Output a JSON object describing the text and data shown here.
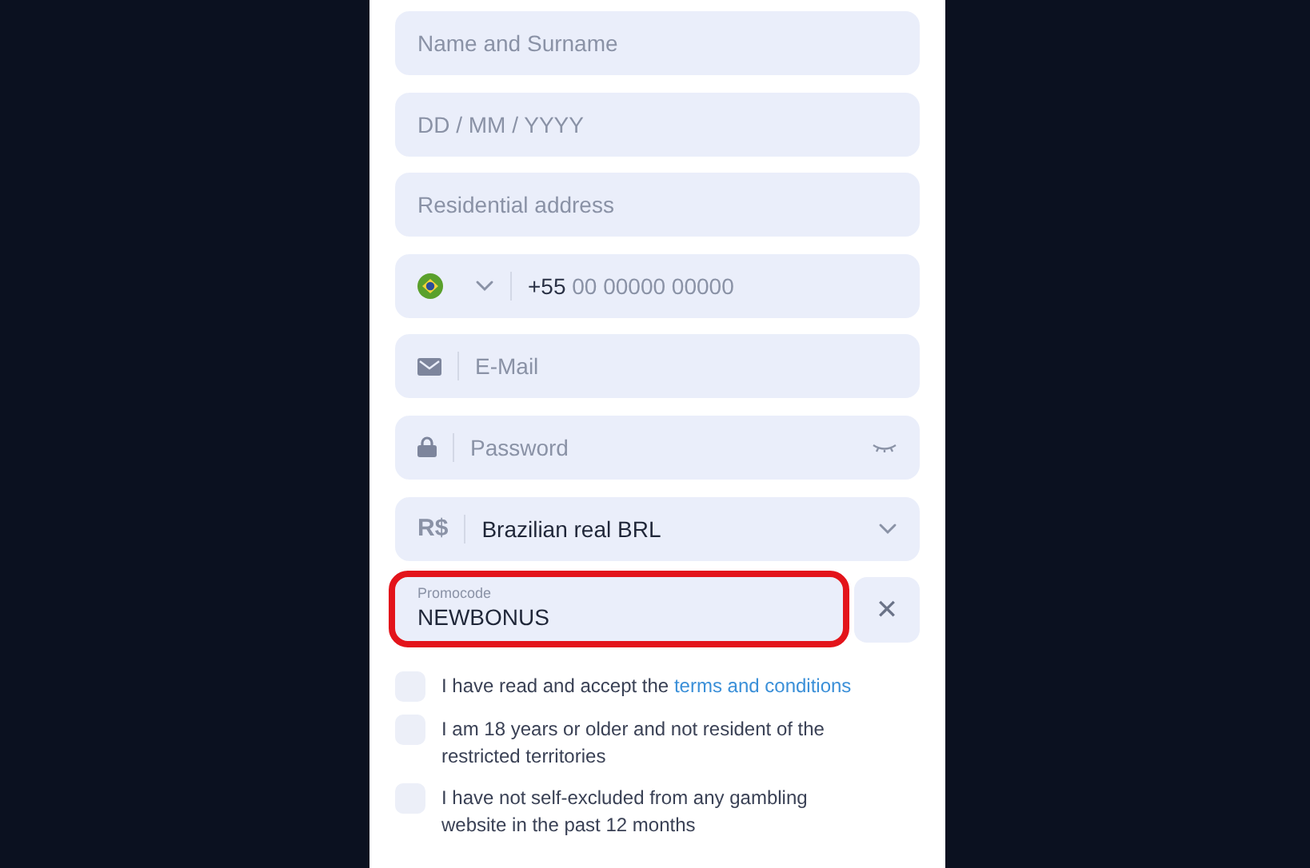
{
  "fields": [
    {
      "kind": "text",
      "placeholder": "Name and Surname"
    },
    {
      "kind": "text",
      "placeholder": "DD / MM / YYYY"
    },
    {
      "kind": "text",
      "placeholder": "Residential address"
    },
    {
      "kind": "phone",
      "prefix": "+55",
      "placeholder": "00 00000 00000"
    },
    {
      "kind": "email",
      "placeholder": "E-Mail"
    },
    {
      "kind": "password",
      "placeholder": "Password"
    },
    {
      "kind": "currency",
      "symbol": "R$",
      "value": "Brazilian real BRL"
    }
  ],
  "promocode": {
    "label": "Promocode",
    "value": "NEWBONUS",
    "highlighted": true,
    "clear_icon": "✕"
  },
  "agreements": [
    {
      "text": "I have read and accept the",
      "link": "terms and conditions",
      "checked": false
    },
    {
      "text": "I am 18 years or older and not resident of the restricted territories",
      "checked": false
    },
    {
      "text": "I have not self-excluded from any gambling website in the past 12 months",
      "checked": false
    }
  ]
}
